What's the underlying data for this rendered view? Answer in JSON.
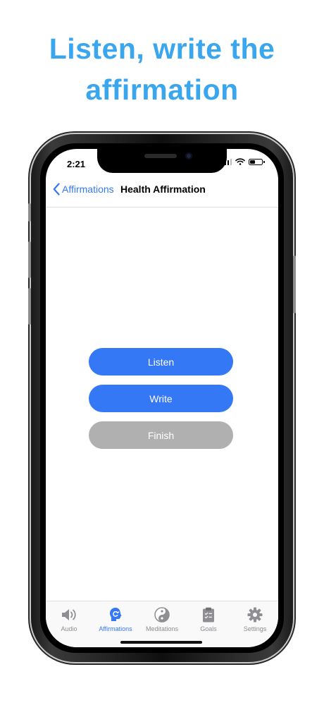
{
  "headline": {
    "line1": "Listen, write the",
    "line2": "affirmation"
  },
  "status_bar": {
    "time": "2:21"
  },
  "nav": {
    "back_label": "Affirmations",
    "title": "Health Affirmation"
  },
  "actions": {
    "listen_label": "Listen",
    "write_label": "Write",
    "finish_label": "Finish"
  },
  "tabs": [
    {
      "label": "Audio",
      "icon": "speaker-icon"
    },
    {
      "label": "Affirmations",
      "icon": "affirmations-icon",
      "active": true
    },
    {
      "label": "Meditations",
      "icon": "yin-yang-icon"
    },
    {
      "label": "Goals",
      "icon": "clipboard-icon"
    },
    {
      "label": "Settings",
      "icon": "gear-icon"
    }
  ],
  "colors": {
    "headline": "#3aa6ee",
    "accent": "#3478f6",
    "disabled_button": "#b0b0b0",
    "tab_inactive": "#8e8e93"
  }
}
